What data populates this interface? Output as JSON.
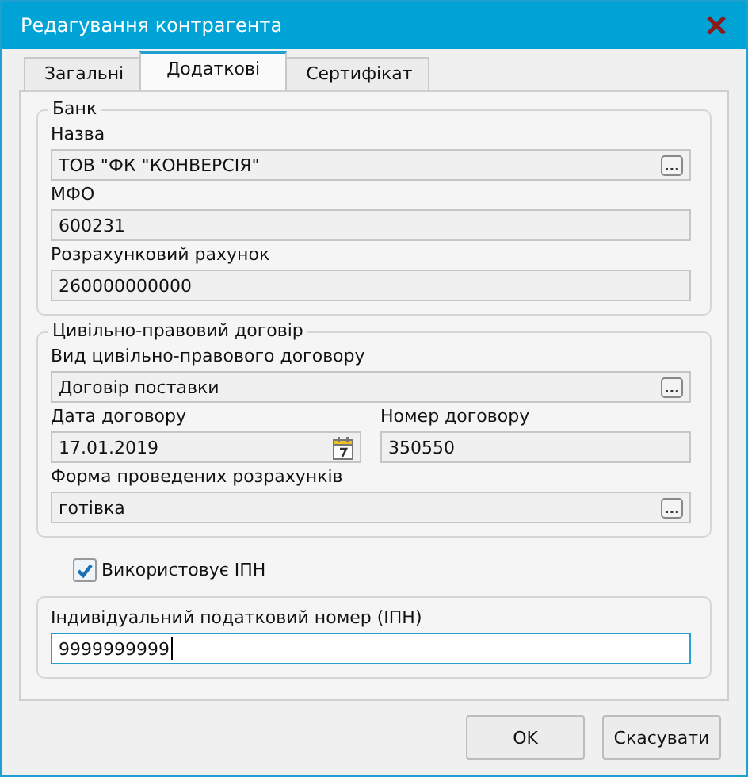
{
  "window": {
    "title": "Редагування контрагента"
  },
  "tabs": [
    {
      "label": "Загальні",
      "selected": false
    },
    {
      "label": "Додаткові",
      "selected": true
    },
    {
      "label": "Сертифікат",
      "selected": false
    }
  ],
  "sections": [
    {
      "kind": "group",
      "title": "Банк",
      "rows": [
        [
          {
            "label": "Назва",
            "value": "ТОВ \"ФК \"КОНВЕРСІЯ\"",
            "kind": "lookup",
            "focused": false
          }
        ],
        [
          {
            "label": "МФО",
            "value": "600231",
            "kind": "text",
            "focused": false
          }
        ],
        [
          {
            "label": "Розрахунковий рахунок",
            "value": "260000000000",
            "kind": "text",
            "focused": false
          }
        ]
      ]
    },
    {
      "kind": "group",
      "title": "Цивільно-правовий договір",
      "rows": [
        [
          {
            "label": "Вид цивільно-правового договору",
            "value": "Договір поставки",
            "kind": "lookup",
            "focused": false
          }
        ],
        [
          {
            "label": "Дата договору",
            "value": "17.01.2019",
            "kind": "date",
            "focused": false
          },
          {
            "label": "Номер договору",
            "value": "350550",
            "kind": "text",
            "focused": false
          }
        ],
        [
          {
            "label": "Форма проведених розрахунків",
            "value": "готівка",
            "kind": "lookup",
            "focused": false
          }
        ]
      ]
    },
    {
      "kind": "checkbox",
      "label": "Використовує ІПН",
      "checked": true
    },
    {
      "kind": "group",
      "rows": [
        [
          {
            "label": "Індивідуальний податковий номер (ІПН)",
            "value": "9999999999",
            "kind": "text",
            "focused": true
          }
        ]
      ]
    }
  ],
  "buttons": [
    "OK",
    "Скасувати"
  ]
}
